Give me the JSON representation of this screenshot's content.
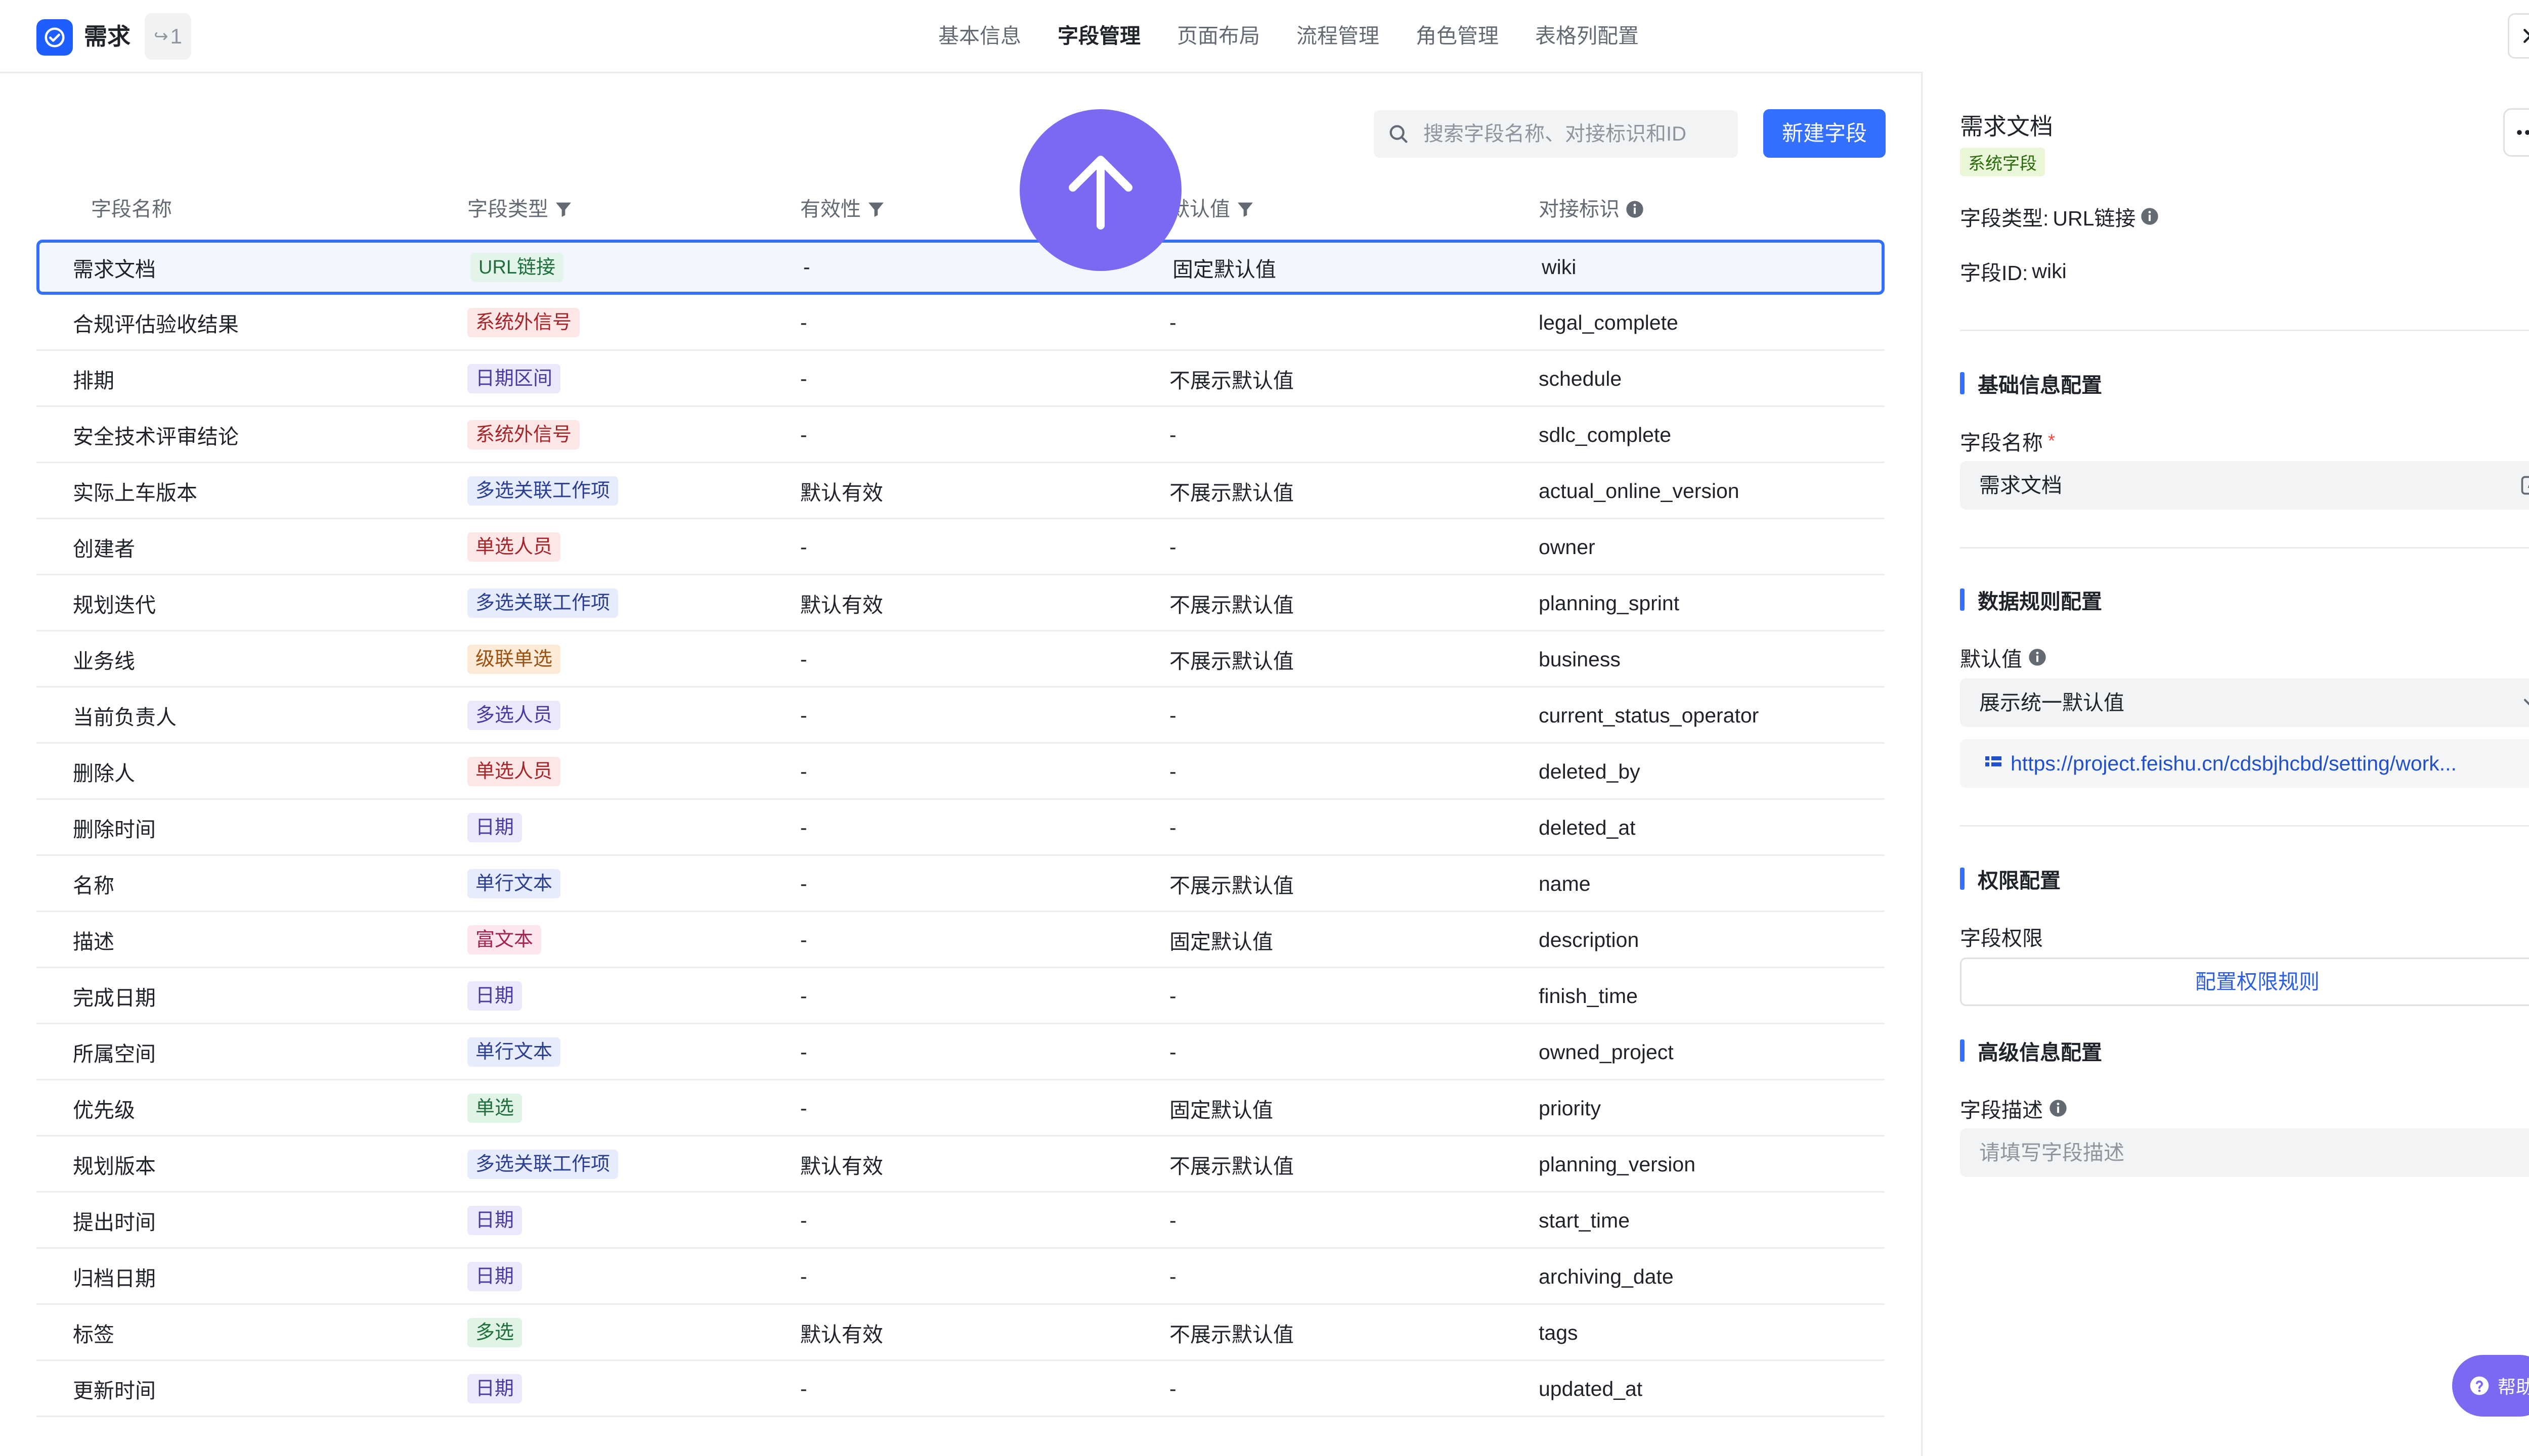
{
  "app": {
    "title": "需求",
    "share_count": "1",
    "accent": "#1e5eff"
  },
  "tabs": [
    {
      "label": "基本信息",
      "active": false
    },
    {
      "label": "字段管理",
      "active": true
    },
    {
      "label": "页面布局",
      "active": false
    },
    {
      "label": "流程管理",
      "active": false
    },
    {
      "label": "角色管理",
      "active": false
    },
    {
      "label": "表格列配置",
      "active": false
    }
  ],
  "toolbar": {
    "search_placeholder": "搜索字段名称、对接标识和ID",
    "new_button": "新建字段"
  },
  "table": {
    "headers": [
      "字段名称",
      "字段类型",
      "有效性",
      "默认值",
      "对接标识"
    ],
    "rows": [
      {
        "name": "需求文档",
        "type": "URL链接",
        "valid": "-",
        "default": "固定默认值",
        "key": "wiki",
        "tag": "#e3f5ea",
        "tagfg": "#1f6e3c"
      },
      {
        "name": "合规评估验收结果",
        "type": "系统外信号",
        "valid": "-",
        "default": "-",
        "key": "legal_complete",
        "tag": "#fde6e6",
        "tagfg": "#a3262a"
      },
      {
        "name": "排期",
        "type": "日期区间",
        "valid": "-",
        "default": "不展示默认值",
        "key": "schedule",
        "tag": "#ece8fb",
        "tagfg": "#4b3a9e"
      },
      {
        "name": "安全技术评审结论",
        "type": "系统外信号",
        "valid": "-",
        "default": "-",
        "key": "sdlc_complete",
        "tag": "#fde6e6",
        "tagfg": "#a3262a"
      },
      {
        "name": "实际上车版本",
        "type": "多选关联工作项",
        "valid": "默认有效",
        "default": "不展示默认值",
        "key": "actual_online_version",
        "tag": "#e6ecfb",
        "tagfg": "#2c3f8f"
      },
      {
        "name": "创建者",
        "type": "单选人员",
        "valid": "-",
        "default": "-",
        "key": "owner",
        "tag": "#fde6e6",
        "tagfg": "#a3262a"
      },
      {
        "name": "规划迭代",
        "type": "多选关联工作项",
        "valid": "默认有效",
        "default": "不展示默认值",
        "key": "planning_sprint",
        "tag": "#e6ecfb",
        "tagfg": "#2c3f8f"
      },
      {
        "name": "业务线",
        "type": "级联单选",
        "valid": "-",
        "default": "不展示默认值",
        "key": "business",
        "tag": "#fdebd8",
        "tagfg": "#9a5213"
      },
      {
        "name": "当前负责人",
        "type": "多选人员",
        "valid": "-",
        "default": "-",
        "key": "current_status_operator",
        "tag": "#ece8fb",
        "tagfg": "#4b3a9e"
      },
      {
        "name": "删除人",
        "type": "单选人员",
        "valid": "-",
        "default": "-",
        "key": "deleted_by",
        "tag": "#fde6e6",
        "tagfg": "#a3262a"
      },
      {
        "name": "删除时间",
        "type": "日期",
        "valid": "-",
        "default": "-",
        "key": "deleted_at",
        "tag": "#ece8fb",
        "tagfg": "#4b3a9e"
      },
      {
        "name": "名称",
        "type": "单行文本",
        "valid": "-",
        "default": "不展示默认值",
        "key": "name",
        "tag": "#e6ecfb",
        "tagfg": "#2c3f8f"
      },
      {
        "name": "描述",
        "type": "富文本",
        "valid": "-",
        "default": "固定默认值",
        "key": "description",
        "tag": "#fde6ee",
        "tagfg": "#a3264f"
      },
      {
        "name": "完成日期",
        "type": "日期",
        "valid": "-",
        "default": "-",
        "key": "finish_time",
        "tag": "#ece8fb",
        "tagfg": "#4b3a9e"
      },
      {
        "name": "所属空间",
        "type": "单行文本",
        "valid": "-",
        "default": "-",
        "key": "owned_project",
        "tag": "#e6ecfb",
        "tagfg": "#2c3f8f"
      },
      {
        "name": "优先级",
        "type": "单选",
        "valid": "-",
        "default": "固定默认值",
        "key": "priority",
        "tag": "#e0f4e6",
        "tagfg": "#1f6e3c"
      },
      {
        "name": "规划版本",
        "type": "多选关联工作项",
        "valid": "默认有效",
        "default": "不展示默认值",
        "key": "planning_version",
        "tag": "#e6ecfb",
        "tagfg": "#2c3f8f"
      },
      {
        "name": "提出时间",
        "type": "日期",
        "valid": "-",
        "default": "-",
        "key": "start_time",
        "tag": "#ece8fb",
        "tagfg": "#4b3a9e"
      },
      {
        "name": "归档日期",
        "type": "日期",
        "valid": "-",
        "default": "-",
        "key": "archiving_date",
        "tag": "#ece8fb",
        "tagfg": "#4b3a9e"
      },
      {
        "name": "标签",
        "type": "多选",
        "valid": "默认有效",
        "default": "不展示默认值",
        "key": "tags",
        "tag": "#e0f4e6",
        "tagfg": "#1f6e3c"
      },
      {
        "name": "更新时间",
        "type": "日期",
        "valid": "-",
        "default": "-",
        "key": "updated_at",
        "tag": "#ece8fb",
        "tagfg": "#4b3a9e"
      }
    ]
  },
  "panel": {
    "title": "需求文档",
    "badge": "系统字段",
    "type_label": "字段类型:",
    "type_value": "URL链接",
    "id_label": "字段ID:",
    "id_value": "wiki",
    "sec_basic": "基础信息配置",
    "name_label": "字段名称",
    "name_required": "*",
    "name_value": "需求文档",
    "sec_data": "数据规则配置",
    "default_label": "默认值",
    "default_value": "展示统一默认值",
    "link": "https://project.feishu.cn/cdsbjhcbd/setting/work...",
    "sec_perm": "权限配置",
    "perm_label": "字段权限",
    "perm_button": "配置权限规则",
    "sec_adv": "高级信息配置",
    "desc_label": "字段描述",
    "desc_placeholder": "请填写字段描述"
  },
  "help": {
    "label": "帮助"
  }
}
